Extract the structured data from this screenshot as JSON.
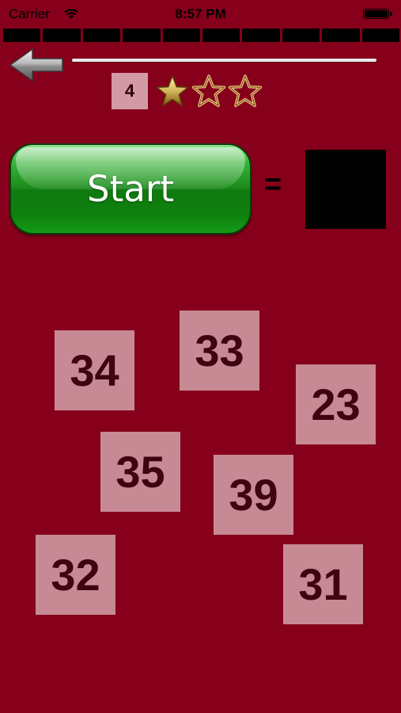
{
  "status_bar": {
    "carrier": "Carrier",
    "time": "8:57 PM"
  },
  "header": {
    "level": "4",
    "stars_earned": 1,
    "stars_total": 3,
    "segments": 10
  },
  "start_button": {
    "label": "Start"
  },
  "equation": {
    "equals": "=",
    "answer": ""
  },
  "tiles": [
    "34",
    "33",
    "23",
    "35",
    "39",
    "32",
    "31"
  ],
  "colors": {
    "background": "#86001b",
    "tile": "#c78a95",
    "tile_text": "#3e0410",
    "start_green": "#1c8d1c",
    "star_gold": "#d6b65a"
  }
}
